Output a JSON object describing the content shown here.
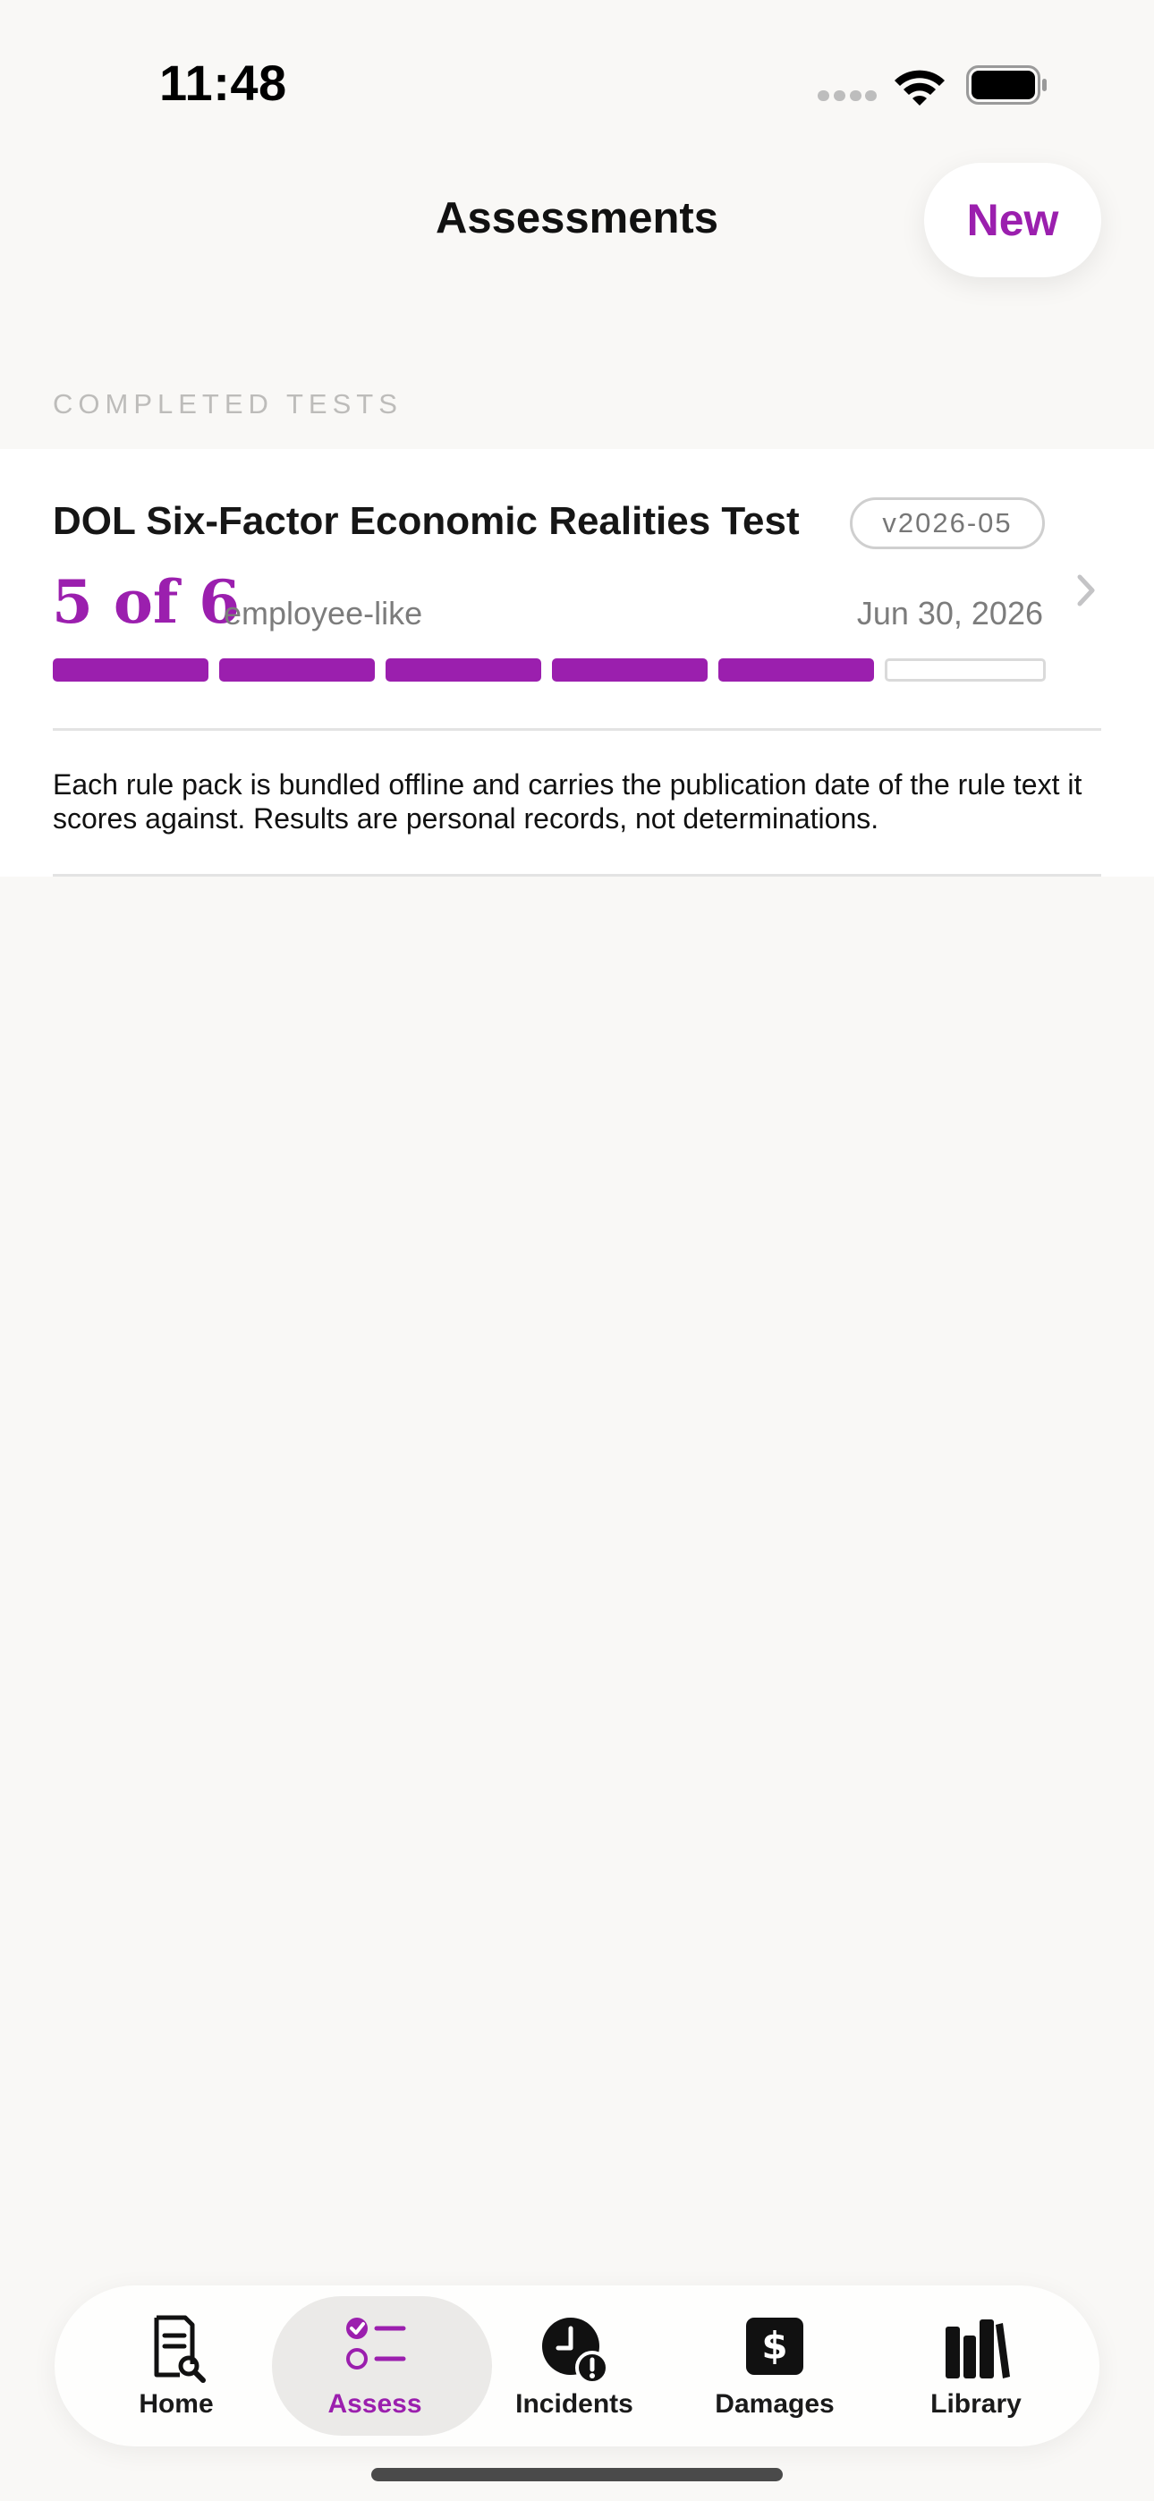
{
  "status_bar": {
    "time": "11:48",
    "icons": [
      "signal-icon",
      "wifi-icon",
      "battery-icon"
    ]
  },
  "header": {
    "title": "Assessments",
    "new_button_label": "New"
  },
  "section": {
    "header": "COMPLETED TESTS"
  },
  "tests": [
    {
      "title": "DOL Six-Factor Economic Realities Test",
      "version": "v2026-05",
      "score_text": "5 of 6",
      "classification": "employee-like",
      "date": "Jun 30, 2026",
      "factors_met": 5,
      "factors_total": 6
    }
  ],
  "footnote": "Each rule pack is bundled offline and carries the publication date of the rule text it scores against. Results are personal records, not determinations.",
  "tab_bar": {
    "active": "Assess",
    "tabs": [
      {
        "label": "Home",
        "icon": "document-search-icon"
      },
      {
        "label": "Assess",
        "icon": "checklist-icon"
      },
      {
        "label": "Incidents",
        "icon": "clock-alert-icon"
      },
      {
        "label": "Damages",
        "icon": "dollar-icon"
      },
      {
        "label": "Library",
        "icon": "books-icon"
      }
    ]
  },
  "colors": {
    "accent": "#9b1fae",
    "background": "#f9f8f6",
    "card": "#ffffff",
    "muted_text": "#7c7c7c"
  }
}
